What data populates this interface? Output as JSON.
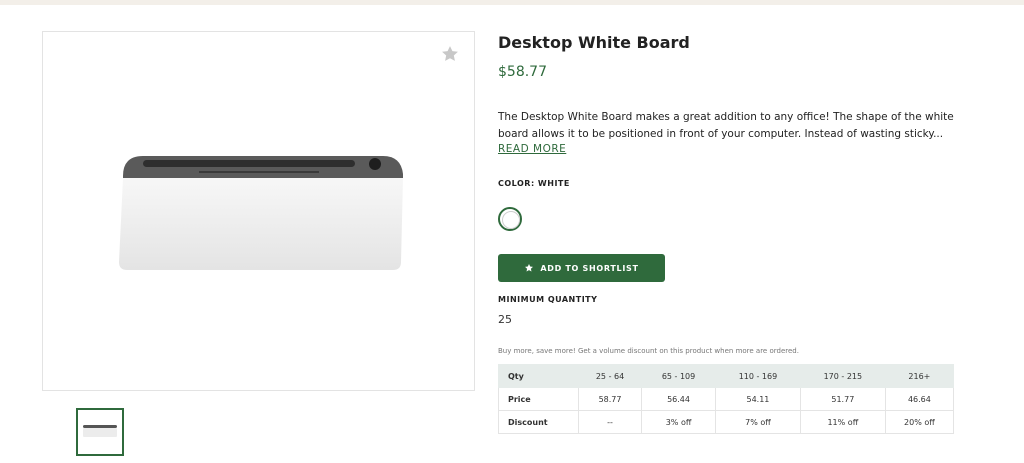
{
  "product": {
    "title": "Desktop White Board",
    "price": "$58.77",
    "description_lines": [
      "The Desktop White Board makes a great addition to any office! The shape of the white",
      "board allows it to be positioned in front of your computer. Instead of wasting sticky..."
    ],
    "read_more": "READ MORE",
    "color_label": "COLOR: WHITE",
    "swatch_color": "#ffffff",
    "shortlist_button": "ADD TO SHORTLIST",
    "min_qty_label": "MINIMUM QUANTITY",
    "min_qty_value": "25",
    "volume_note": "Buy more, save more! Get a volume discount on this product when more are ordered."
  },
  "icons": {
    "favorite": "star-icon",
    "shortlist": "star-icon"
  },
  "colors": {
    "accent": "#2f6a3c",
    "topbar": "#f3efe9",
    "table_header": "#e6ecea"
  },
  "pricing_table": {
    "rows": [
      {
        "label": "Qty",
        "cells": [
          "25 - 64",
          "65 - 109",
          "110 - 169",
          "170 - 215",
          "216+"
        ]
      },
      {
        "label": "Price",
        "cells": [
          "58.77",
          "56.44",
          "54.11",
          "51.77",
          "46.64"
        ]
      },
      {
        "label": "Discount",
        "cells": [
          "--",
          "3% off",
          "7% off",
          "11% off",
          "20% off"
        ]
      }
    ]
  }
}
